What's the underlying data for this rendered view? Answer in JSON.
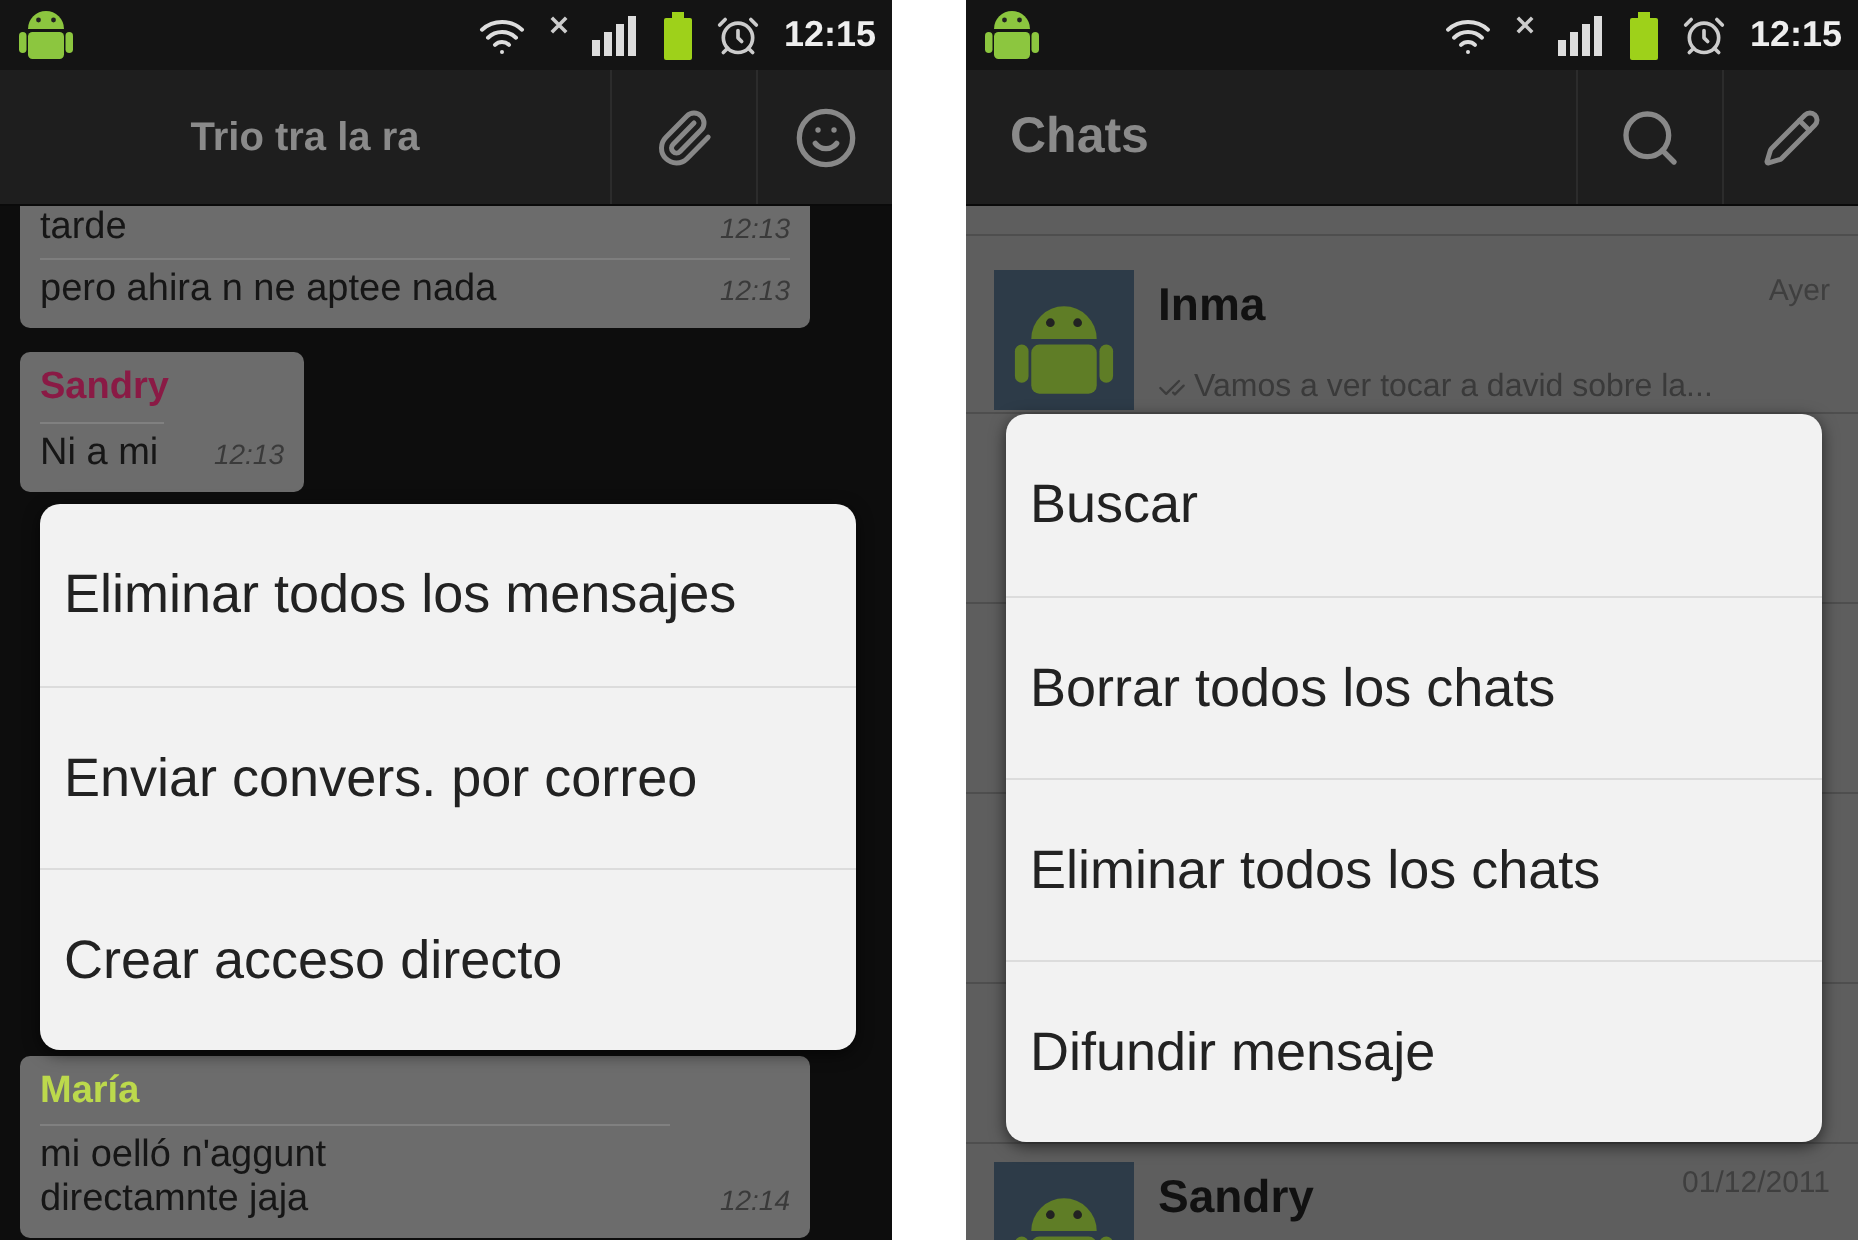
{
  "screens": [
    {
      "kind": "conversation",
      "status_bar": {
        "time": "12:15"
      },
      "action_bar": {
        "title": "Trio tra la ra"
      },
      "messages": [
        {
          "lines": [
            {
              "text": "tarde",
              "time": "12:13"
            },
            {
              "text": "pero ahira n ne aptee nada",
              "time": "12:13"
            }
          ]
        },
        {
          "sender": "Sandry",
          "color": "#8a1a45",
          "lines": [
            {
              "text": "Ni a mi",
              "time": "12:13"
            }
          ]
        },
        {
          "sender": "María",
          "color": "#bcd94c",
          "lines": [
            {
              "text": "mi oelló n'aggunt\ndirectamnte jaja",
              "time": "12:14"
            }
          ]
        }
      ],
      "menu": [
        "Eliminar todos los mensajes",
        "Enviar convers. por correo",
        "Crear acceso directo"
      ]
    },
    {
      "kind": "chat_list",
      "status_bar": {
        "time": "12:15"
      },
      "action_bar": {
        "title": "Chats"
      },
      "chats": [
        {
          "name": "Inma",
          "time": "Ayer",
          "preview": "Vamos a ver tocar a david sobre la...",
          "delivered": true
        },
        {
          "name": "Sandry",
          "time": "01/12/2011"
        }
      ],
      "menu": [
        "Buscar",
        "Borrar todos los chats",
        "Eliminar todos los chats",
        "Difundir mensaje"
      ]
    }
  ]
}
